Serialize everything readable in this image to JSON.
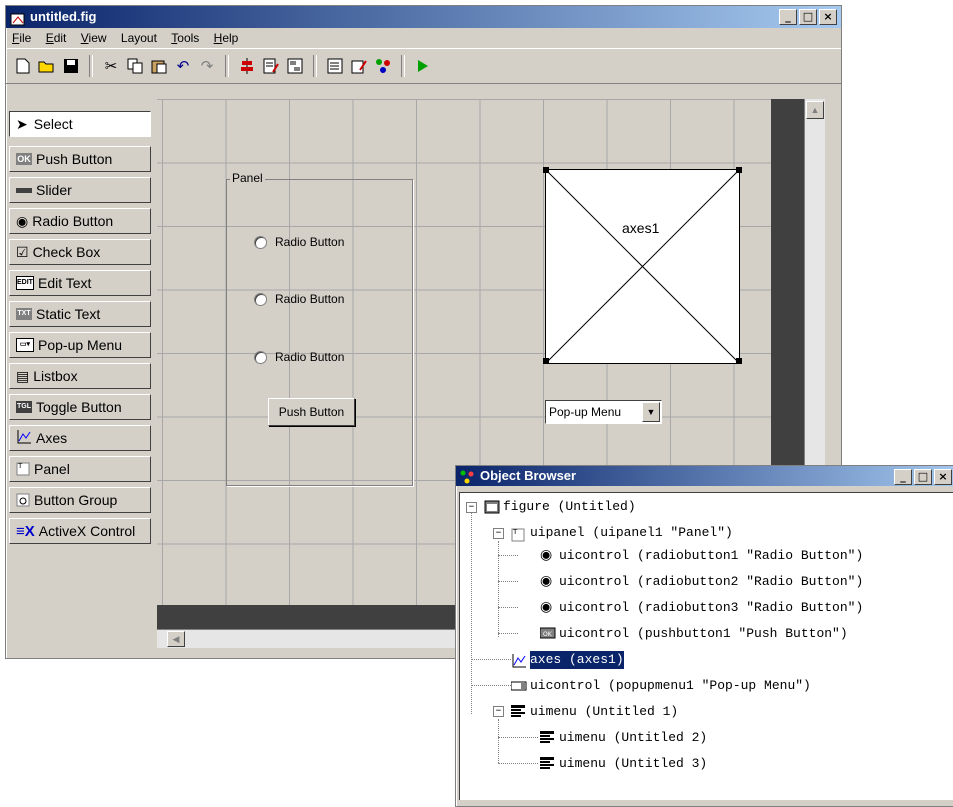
{
  "guide": {
    "title": "untitled.fig",
    "window_buttons": [
      "_",
      "□",
      "×"
    ],
    "menu": [
      {
        "key": "F",
        "rest": "ile"
      },
      {
        "key": "E",
        "rest": "dit"
      },
      {
        "key": "V",
        "rest": "iew"
      },
      {
        "key": "",
        "rest": "Layout"
      },
      {
        "key": "T",
        "rest": "ools"
      },
      {
        "key": "H",
        "rest": "elp"
      }
    ],
    "toolbar_icons": [
      "new-icon",
      "open-icon",
      "save-icon",
      "cut-icon",
      "copy-icon",
      "paste-icon",
      "undo-icon",
      "redo-icon",
      "align-icon",
      "menu-editor-icon",
      "tab-order-icon",
      "m-file-editor-icon",
      "property-inspector-icon",
      "object-browser-icon",
      "run-icon"
    ],
    "palette": [
      {
        "label": "Select",
        "icon": "arrow-icon"
      },
      {
        "label": "Push Button",
        "icon": "push-button-icon"
      },
      {
        "label": "Slider",
        "icon": "slider-icon"
      },
      {
        "label": "Radio Button",
        "icon": "radio-button-icon"
      },
      {
        "label": "Check Box",
        "icon": "check-box-icon"
      },
      {
        "label": "Edit Text",
        "icon": "edit-text-icon"
      },
      {
        "label": "Static Text",
        "icon": "static-text-icon"
      },
      {
        "label": "Pop-up Menu",
        "icon": "popup-menu-icon"
      },
      {
        "label": "Listbox",
        "icon": "listbox-icon"
      },
      {
        "label": "Toggle Button",
        "icon": "toggle-button-icon"
      },
      {
        "label": "Axes",
        "icon": "axes-icon"
      },
      {
        "label": "Panel",
        "icon": "panel-icon"
      },
      {
        "label": "Button Group",
        "icon": "button-group-icon"
      },
      {
        "label": "ActiveX Control",
        "icon": "activex-icon"
      }
    ],
    "canvas": {
      "panel_title": "Panel",
      "radio_buttons": [
        "Radio Button",
        "Radio Button",
        "Radio Button"
      ],
      "push_button": "Push Button",
      "axes_label": "axes1",
      "popup_value": "Pop-up Menu"
    }
  },
  "object_browser": {
    "title": "Object Browser",
    "nodes": [
      {
        "text": "figure (Untitled)",
        "icon": "figure-icon"
      },
      {
        "text": "uipanel (uipanel1 \"Panel\")",
        "icon": "panel-icon"
      },
      {
        "text": "uicontrol (radiobutton1 \"Radio Button\")",
        "icon": "radio-button-icon"
      },
      {
        "text": "uicontrol (radiobutton2 \"Radio Button\")",
        "icon": "radio-button-icon"
      },
      {
        "text": "uicontrol (radiobutton3 \"Radio Button\")",
        "icon": "radio-button-icon"
      },
      {
        "text": "uicontrol (pushbutton1 \"Push Button\")",
        "icon": "push-button-icon"
      },
      {
        "text": "axes (axes1)",
        "icon": "axes-icon",
        "selected": true
      },
      {
        "text": "uicontrol (popupmenu1 \"Pop-up Menu\")",
        "icon": "popup-menu-icon"
      },
      {
        "text": "uimenu (Untitled 1)",
        "icon": "uimenu-icon"
      },
      {
        "text": "uimenu (Untitled 2)",
        "icon": "uimenu-icon"
      },
      {
        "text": "uimenu (Untitled 3)",
        "icon": "uimenu-icon"
      }
    ]
  },
  "colors": {
    "titlebar": "#0a246a",
    "face": "#d4d0c8",
    "selection": "#0a246a"
  }
}
